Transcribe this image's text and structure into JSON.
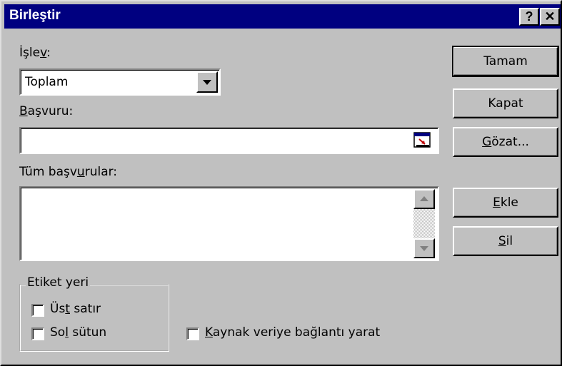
{
  "window": {
    "title": "Birleştir"
  },
  "title_buttons": {
    "help": "?",
    "close": "✕"
  },
  "function": {
    "label_before": "İşle",
    "label_underlined": "v",
    "label_after": ":",
    "selected": "Toplam"
  },
  "reference": {
    "label_before": "",
    "label_underlined": "B",
    "label_after": "aşvuru:",
    "value": ""
  },
  "all_references": {
    "label_before": "Tüm başv",
    "label_underlined": "u",
    "label_after": "rular:"
  },
  "buttons": {
    "ok": "Tamam",
    "close": "Kapat",
    "browse_before": "",
    "browse_underlined": "G",
    "browse_after": "özat...",
    "add_before": "",
    "add_underlined": "E",
    "add_after": "kle",
    "delete_before": "",
    "delete_underlined": "S",
    "delete_after": "il"
  },
  "label_location": {
    "title": "Etiket yeri",
    "top_row_before": "Üs",
    "top_row_underlined": "t",
    "top_row_after": " satır",
    "left_column_before": "So",
    "left_column_underlined": "l",
    "left_column_after": " sütun"
  },
  "links": {
    "before": "",
    "underlined": "K",
    "after": "aynak veriye bağlantı yarat"
  }
}
